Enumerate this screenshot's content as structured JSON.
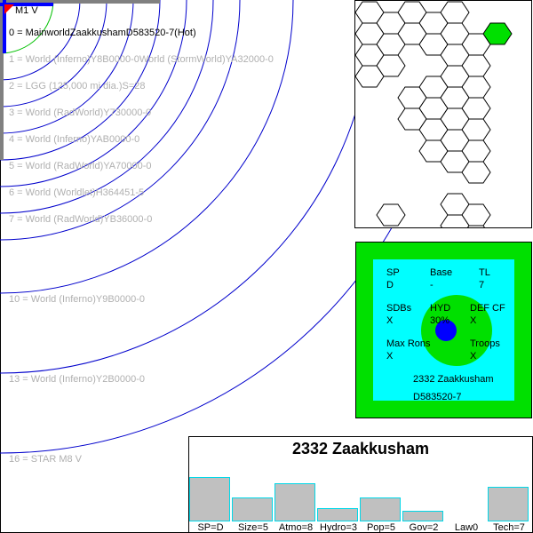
{
  "star": {
    "label": "M1 V"
  },
  "orbits": [
    {
      "label": "0 = MainworldZaakkushamD583520-7(Hot)",
      "main": true
    },
    {
      "label": "1 = World  (Inferno)Y8B0000-0World  (StormWorld)YA32000-0"
    },
    {
      "label": "2 = LGG (125,000 mi dia.)S=28"
    },
    {
      "label": "3 = World  (RadWorld)Y730000-0"
    },
    {
      "label": "4 = World  (Inferno)YAB0000-0"
    },
    {
      "label": "5 = World  (RadWorld)YA70000-0"
    },
    {
      "label": "6 = World  (Worldlet)H364451-5"
    },
    {
      "label": "7 = World  (RadWorld)YB36000-0"
    },
    {
      "label": "10 = World  (Inferno)Y9B0000-0"
    },
    {
      "label": "13 = World  (Inferno)Y2B0000-0"
    },
    {
      "label": "16 = STAR M8 V"
    }
  ],
  "uwp": {
    "sp_label": "SP",
    "sp_value": "D",
    "base_label": "Base",
    "base_value": "-",
    "tl_label": "TL",
    "tl_value": "7",
    "sdbs_label": "SDBs",
    "sdbs_value": "X",
    "hyd_label": "HYD",
    "hyd_value": "30%",
    "defcf_label": "DEF CF",
    "defcf_value": "X",
    "maxrons_label": "Max Rons",
    "maxrons_value": "X",
    "troops_label": "Troops",
    "troops_value": "X",
    "world_name": "2332 Zaakkusham",
    "world_code": "D583520-7"
  },
  "profile": {
    "title": "2332 Zaakkusham",
    "bars": [
      {
        "label": "SP=D",
        "level": 13
      },
      {
        "label": "Size=5",
        "level": 7
      },
      {
        "label": "Atmo=8",
        "level": 11
      },
      {
        "label": "Hydro=3",
        "level": 4
      },
      {
        "label": "Pop=5",
        "level": 7
      },
      {
        "label": "Gov=2",
        "level": 3
      },
      {
        "label": "Law0",
        "level": 0
      },
      {
        "label": "Tech=7",
        "level": 10
      }
    ]
  },
  "colors": {
    "orbit": "#0000cc",
    "hex_highlight": "#00e000",
    "panel_green": "#00e000",
    "panel_cyan": "#00ffff"
  }
}
